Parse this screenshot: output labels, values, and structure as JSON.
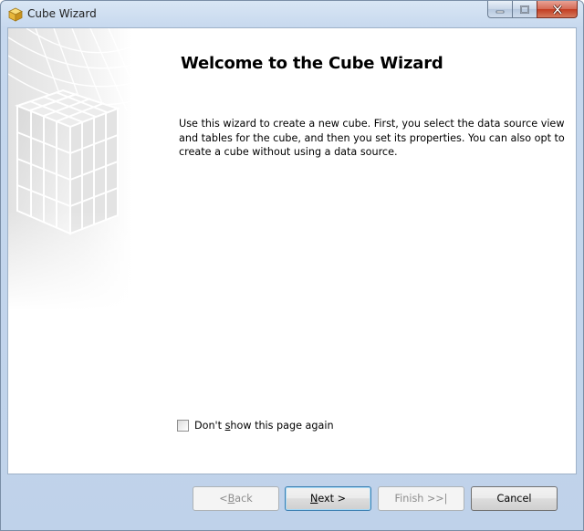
{
  "window": {
    "title": "Cube Wizard",
    "icon": "cube-app-icon"
  },
  "caption_buttons": {
    "minimize": "minimize-icon",
    "maximize": "maximize-icon",
    "close": "close-icon"
  },
  "page": {
    "heading": "Welcome to the Cube Wizard",
    "intro": "Use this wizard to create a new cube. First, you select the data source view and tables for the cube, and then you set its properties. You can also opt to create a cube without using a data source."
  },
  "dont_show": {
    "label_before": "Don't ",
    "label_accel": "s",
    "label_after": "how this page again",
    "checked": false
  },
  "buttons": {
    "back_pre": "< ",
    "back_accel": "B",
    "back_post": "ack",
    "next_accel": "N",
    "next_post": "ext >",
    "finish": "Finish >>|",
    "cancel": "Cancel"
  },
  "colors": {
    "title_bar": "#c6d8ee",
    "close_button": "#c23c21",
    "default_button_border": "#3c7fb1"
  }
}
